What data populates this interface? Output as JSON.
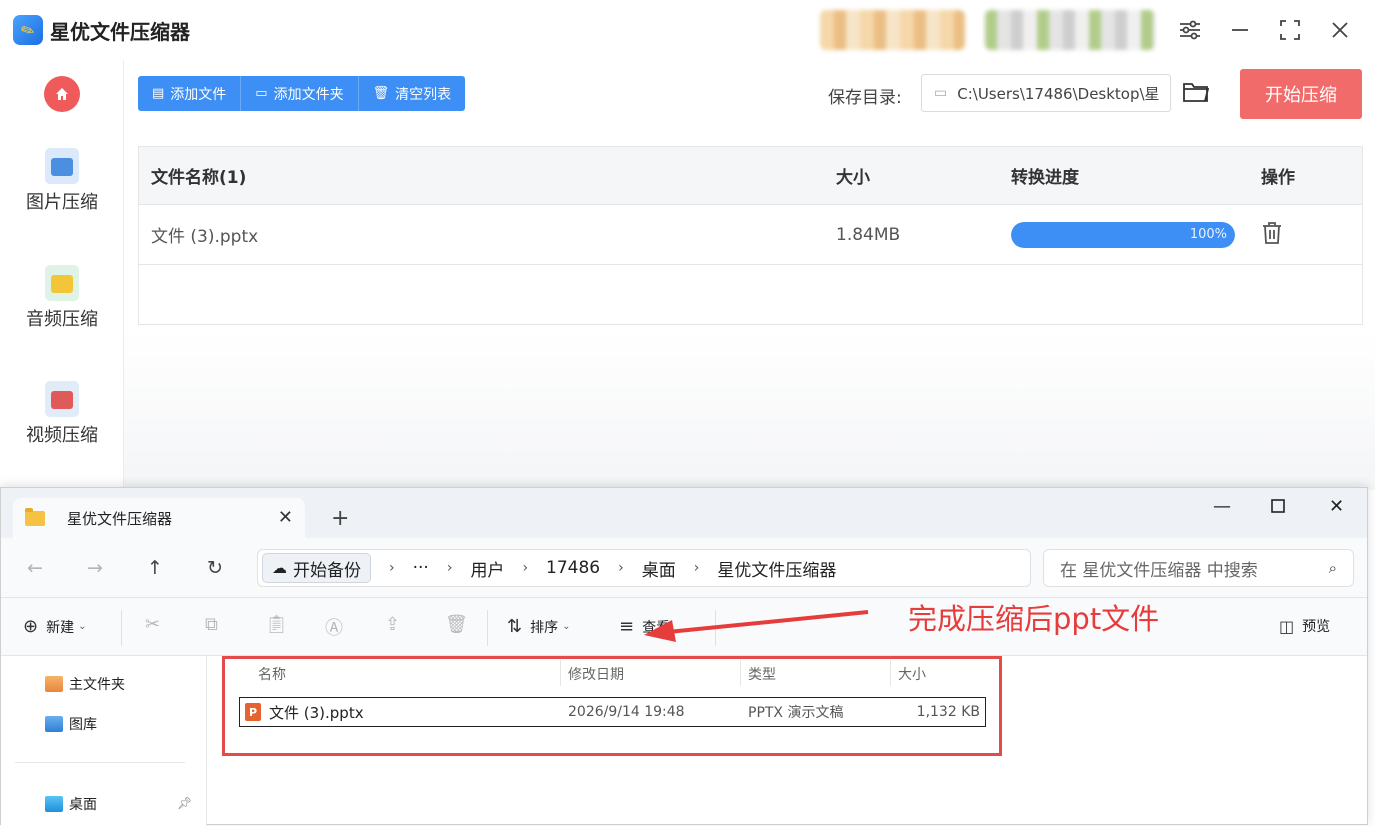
{
  "app": {
    "title": "星优文件压缩器",
    "sidebar": {
      "items": [
        {
          "label": "图片压缩"
        },
        {
          "label": "音频压缩"
        },
        {
          "label": "视频压缩"
        }
      ]
    },
    "toolbar": {
      "add_file": "添加文件",
      "add_folder": "添加文件夹",
      "clear_list": "清空列表"
    },
    "save": {
      "label": "保存目录:",
      "path": "C:\\Users\\17486\\Desktop\\星"
    },
    "start_button": "开始压缩",
    "table": {
      "headers": [
        "文件名称(1)",
        "大小",
        "转换进度",
        "操作"
      ],
      "rows": [
        {
          "name": "文件 (3).pptx",
          "size": "1.84MB",
          "progress": 100,
          "progress_label": "100%"
        }
      ]
    },
    "colors": {
      "accent": "#3d8ff5",
      "start": "#f26b6b"
    }
  },
  "explorer": {
    "tab_title": "星优文件压缩器",
    "backup_label": "开始备份",
    "breadcrumb": [
      "···",
      "用户",
      "17486",
      "桌面",
      "星优文件压缩器"
    ],
    "search_placeholder": "在 星优文件压缩器 中搜索",
    "commands": {
      "new": "新建",
      "sort": "排序",
      "view": "查看",
      "preview": "预览"
    },
    "nav": [
      {
        "label": "主文件夹"
      },
      {
        "label": "图库"
      },
      {
        "label": "桌面"
      }
    ],
    "columns": [
      "名称",
      "修改日期",
      "类型",
      "大小"
    ],
    "files": [
      {
        "name": "文件 (3).pptx",
        "modified": "2026/9/14 19:48",
        "type": "PPTX 演示文稿",
        "size": "1,132 KB"
      }
    ]
  },
  "annotation": {
    "text": "完成压缩后ppt文件",
    "color": "#e63c3c"
  }
}
